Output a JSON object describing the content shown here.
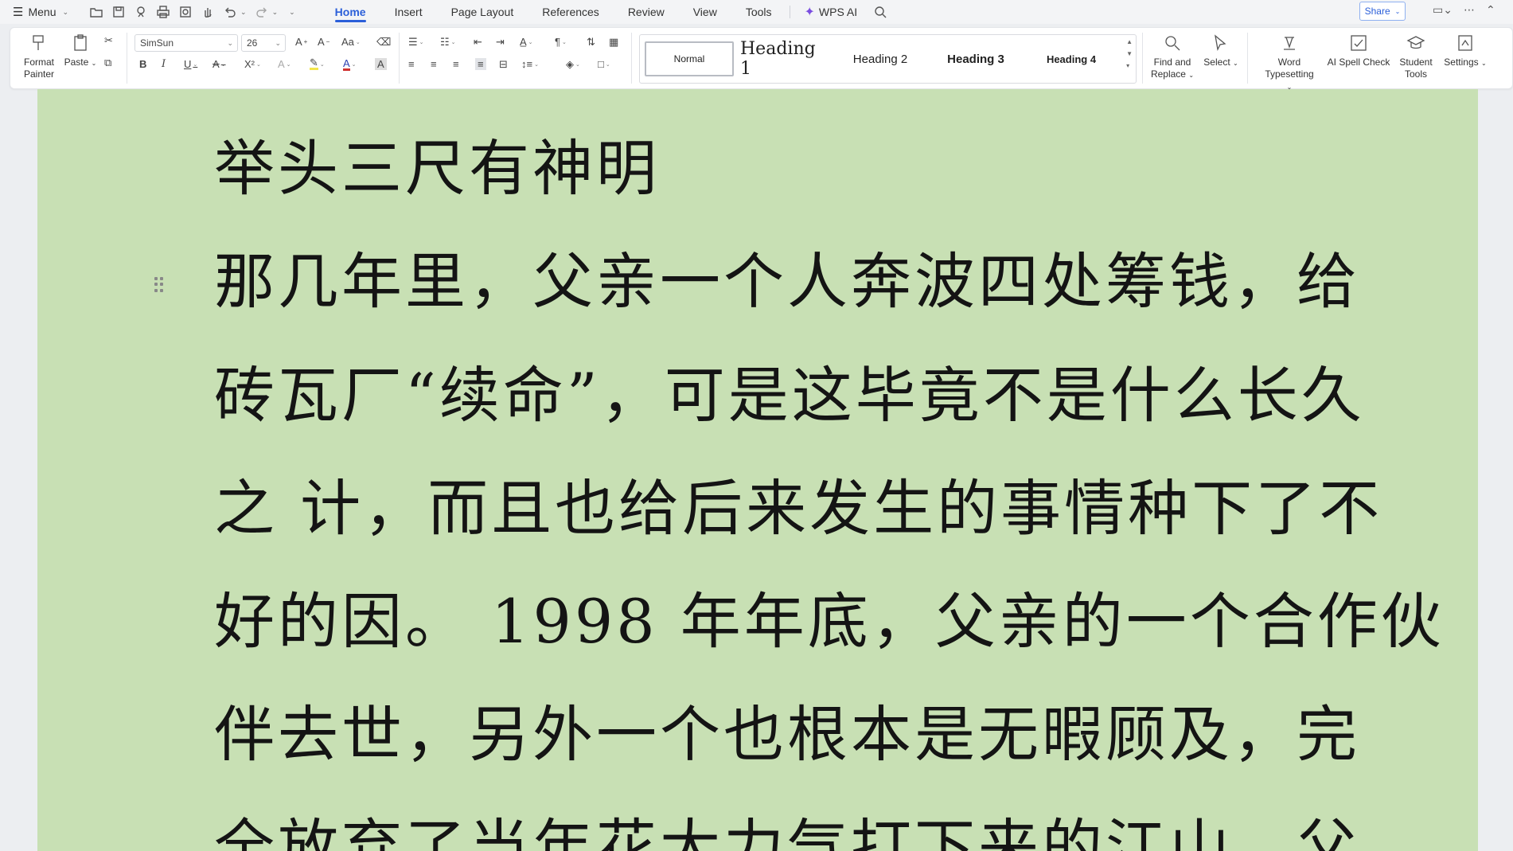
{
  "menubar": {
    "menu_label": "Menu",
    "tabs": [
      "Home",
      "Insert",
      "Page Layout",
      "References",
      "Review",
      "View",
      "Tools"
    ],
    "active_tab": "Home",
    "wps_ai_label": "WPS AI",
    "share_label": "Share"
  },
  "ribbon": {
    "format_painter": "Format Painter",
    "paste": "Paste",
    "font_name": "SimSun",
    "font_size": "26",
    "styles": {
      "normal": "Normal",
      "heading1": "Heading 1",
      "heading2": "Heading 2",
      "heading3": "Heading 3",
      "heading4": "Heading 4"
    },
    "find_replace": "Find and Replace",
    "select": "Select",
    "word_typesetting": "Word Typesetting",
    "ai_spell_check": "AI Spell Check",
    "student_tools": "Student Tools",
    "settings": "Settings"
  },
  "document": {
    "lines": [
      "举头三尺有神明",
      "那几年里，父亲一个人奔波四处筹钱，给",
      "砖瓦厂“续命”，可是这毕竟不是什么长久",
      "之 计，而且也给后来发生的事情种下了不",
      "好的因。 1998 年年底，父亲的一个合作伙",
      "伴去世，另外一个也根本是无暇顾及，完",
      "全放弃了当年花大力气打下来的江山，父"
    ]
  },
  "colors": {
    "accent": "#2b5fd9",
    "page_background": "#c8e0b4",
    "app_background": "#eceef1"
  }
}
